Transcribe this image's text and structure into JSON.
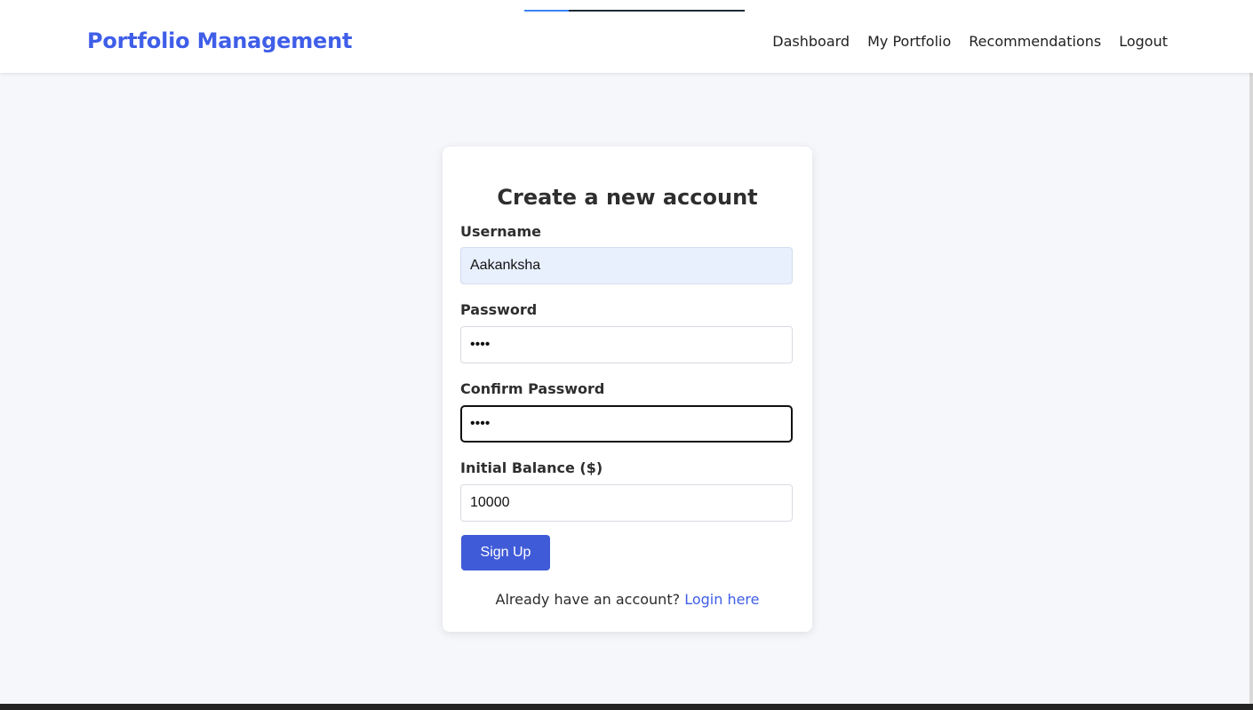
{
  "header": {
    "brand": "Portfolio Management",
    "nav": [
      "Dashboard",
      "My Portfolio",
      "Recommendations",
      "Logout"
    ]
  },
  "loading": {
    "progress": 0.2
  },
  "form": {
    "title": "Create a new account",
    "username_label": "Username",
    "username_value": "Aakanksha",
    "password_label": "Password",
    "password_value": "••••",
    "confirm_label": "Confirm Password",
    "confirm_value": "••••",
    "balance_label": "Initial Balance ($)",
    "balance_value": "10000",
    "submit_label": "Sign Up",
    "login_prompt": "Already have an account?",
    "login_link": "Login here"
  },
  "colors": {
    "brand": "#3f5ee8",
    "button": "#3f5bd8",
    "background": "#f5f7fb"
  }
}
